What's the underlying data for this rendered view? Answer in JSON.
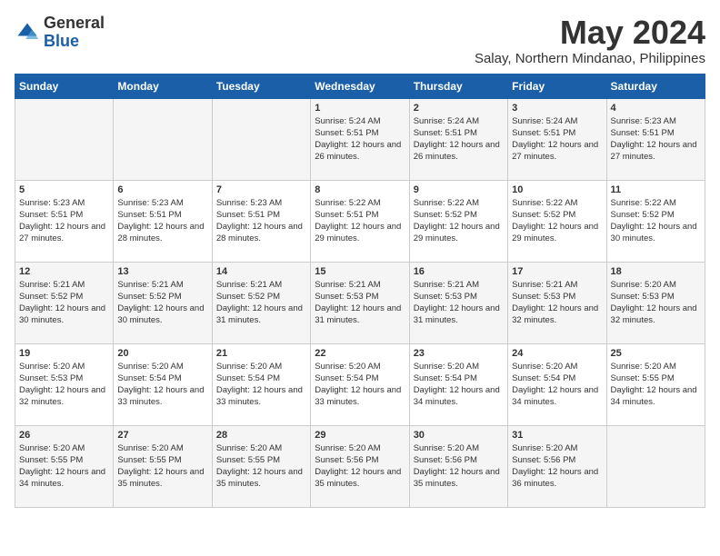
{
  "logo": {
    "general": "General",
    "blue": "Blue"
  },
  "title": {
    "month_year": "May 2024",
    "location": "Salay, Northern Mindanao, Philippines"
  },
  "headers": [
    "Sunday",
    "Monday",
    "Tuesday",
    "Wednesday",
    "Thursday",
    "Friday",
    "Saturday"
  ],
  "weeks": [
    [
      {
        "day": "",
        "info": ""
      },
      {
        "day": "",
        "info": ""
      },
      {
        "day": "",
        "info": ""
      },
      {
        "day": "1",
        "info": "Sunrise: 5:24 AM\nSunset: 5:51 PM\nDaylight: 12 hours and 26 minutes."
      },
      {
        "day": "2",
        "info": "Sunrise: 5:24 AM\nSunset: 5:51 PM\nDaylight: 12 hours and 26 minutes."
      },
      {
        "day": "3",
        "info": "Sunrise: 5:24 AM\nSunset: 5:51 PM\nDaylight: 12 hours and 27 minutes."
      },
      {
        "day": "4",
        "info": "Sunrise: 5:23 AM\nSunset: 5:51 PM\nDaylight: 12 hours and 27 minutes."
      }
    ],
    [
      {
        "day": "5",
        "info": "Sunrise: 5:23 AM\nSunset: 5:51 PM\nDaylight: 12 hours and 27 minutes."
      },
      {
        "day": "6",
        "info": "Sunrise: 5:23 AM\nSunset: 5:51 PM\nDaylight: 12 hours and 28 minutes."
      },
      {
        "day": "7",
        "info": "Sunrise: 5:23 AM\nSunset: 5:51 PM\nDaylight: 12 hours and 28 minutes."
      },
      {
        "day": "8",
        "info": "Sunrise: 5:22 AM\nSunset: 5:51 PM\nDaylight: 12 hours and 29 minutes."
      },
      {
        "day": "9",
        "info": "Sunrise: 5:22 AM\nSunset: 5:52 PM\nDaylight: 12 hours and 29 minutes."
      },
      {
        "day": "10",
        "info": "Sunrise: 5:22 AM\nSunset: 5:52 PM\nDaylight: 12 hours and 29 minutes."
      },
      {
        "day": "11",
        "info": "Sunrise: 5:22 AM\nSunset: 5:52 PM\nDaylight: 12 hours and 30 minutes."
      }
    ],
    [
      {
        "day": "12",
        "info": "Sunrise: 5:21 AM\nSunset: 5:52 PM\nDaylight: 12 hours and 30 minutes."
      },
      {
        "day": "13",
        "info": "Sunrise: 5:21 AM\nSunset: 5:52 PM\nDaylight: 12 hours and 30 minutes."
      },
      {
        "day": "14",
        "info": "Sunrise: 5:21 AM\nSunset: 5:52 PM\nDaylight: 12 hours and 31 minutes."
      },
      {
        "day": "15",
        "info": "Sunrise: 5:21 AM\nSunset: 5:53 PM\nDaylight: 12 hours and 31 minutes."
      },
      {
        "day": "16",
        "info": "Sunrise: 5:21 AM\nSunset: 5:53 PM\nDaylight: 12 hours and 31 minutes."
      },
      {
        "day": "17",
        "info": "Sunrise: 5:21 AM\nSunset: 5:53 PM\nDaylight: 12 hours and 32 minutes."
      },
      {
        "day": "18",
        "info": "Sunrise: 5:20 AM\nSunset: 5:53 PM\nDaylight: 12 hours and 32 minutes."
      }
    ],
    [
      {
        "day": "19",
        "info": "Sunrise: 5:20 AM\nSunset: 5:53 PM\nDaylight: 12 hours and 32 minutes."
      },
      {
        "day": "20",
        "info": "Sunrise: 5:20 AM\nSunset: 5:54 PM\nDaylight: 12 hours and 33 minutes."
      },
      {
        "day": "21",
        "info": "Sunrise: 5:20 AM\nSunset: 5:54 PM\nDaylight: 12 hours and 33 minutes."
      },
      {
        "day": "22",
        "info": "Sunrise: 5:20 AM\nSunset: 5:54 PM\nDaylight: 12 hours and 33 minutes."
      },
      {
        "day": "23",
        "info": "Sunrise: 5:20 AM\nSunset: 5:54 PM\nDaylight: 12 hours and 34 minutes."
      },
      {
        "day": "24",
        "info": "Sunrise: 5:20 AM\nSunset: 5:54 PM\nDaylight: 12 hours and 34 minutes."
      },
      {
        "day": "25",
        "info": "Sunrise: 5:20 AM\nSunset: 5:55 PM\nDaylight: 12 hours and 34 minutes."
      }
    ],
    [
      {
        "day": "26",
        "info": "Sunrise: 5:20 AM\nSunset: 5:55 PM\nDaylight: 12 hours and 34 minutes."
      },
      {
        "day": "27",
        "info": "Sunrise: 5:20 AM\nSunset: 5:55 PM\nDaylight: 12 hours and 35 minutes."
      },
      {
        "day": "28",
        "info": "Sunrise: 5:20 AM\nSunset: 5:55 PM\nDaylight: 12 hours and 35 minutes."
      },
      {
        "day": "29",
        "info": "Sunrise: 5:20 AM\nSunset: 5:56 PM\nDaylight: 12 hours and 35 minutes."
      },
      {
        "day": "30",
        "info": "Sunrise: 5:20 AM\nSunset: 5:56 PM\nDaylight: 12 hours and 35 minutes."
      },
      {
        "day": "31",
        "info": "Sunrise: 5:20 AM\nSunset: 5:56 PM\nDaylight: 12 hours and 36 minutes."
      },
      {
        "day": "",
        "info": ""
      }
    ]
  ]
}
